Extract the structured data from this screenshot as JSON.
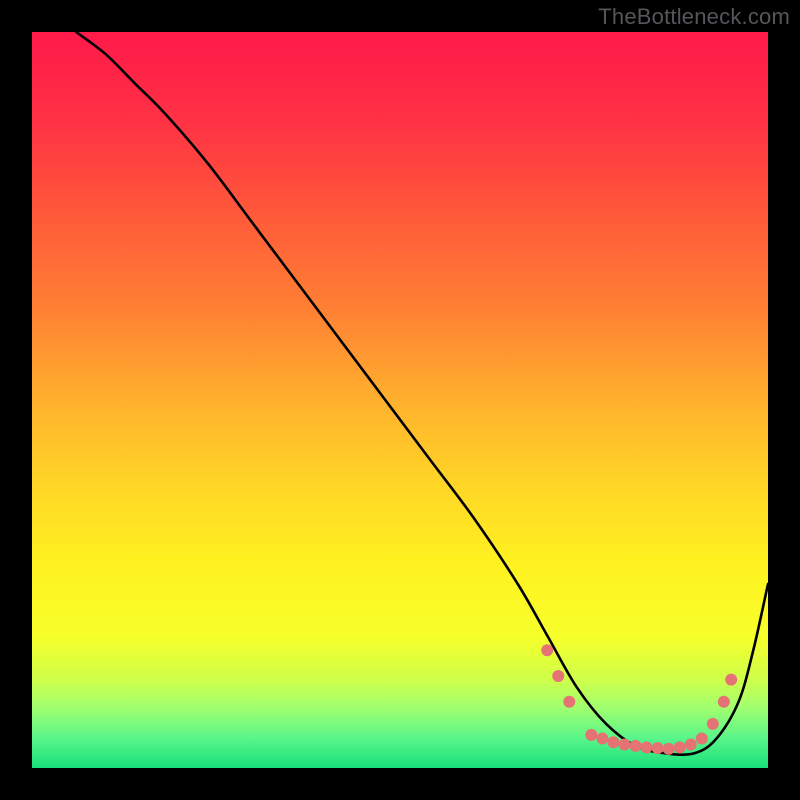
{
  "watermark": "TheBottleneck.com",
  "chart_data": {
    "type": "line",
    "title": "",
    "xlabel": "",
    "ylabel": "",
    "xlim": [
      0,
      100
    ],
    "ylim": [
      0,
      100
    ],
    "grid": false,
    "legend": false,
    "gradient_stops": [
      {
        "offset": 0,
        "color": "#ff1a4a"
      },
      {
        "offset": 12,
        "color": "#ff3144"
      },
      {
        "offset": 25,
        "color": "#ff5a3a"
      },
      {
        "offset": 38,
        "color": "#ff8133"
      },
      {
        "offset": 50,
        "color": "#ffb02d"
      },
      {
        "offset": 62,
        "color": "#ffd726"
      },
      {
        "offset": 72,
        "color": "#fff120"
      },
      {
        "offset": 82,
        "color": "#f7ff2a"
      },
      {
        "offset": 88,
        "color": "#cfff4a"
      },
      {
        "offset": 92,
        "color": "#9eff70"
      },
      {
        "offset": 96,
        "color": "#58f58a"
      },
      {
        "offset": 100,
        "color": "#18e07a"
      }
    ],
    "series": [
      {
        "name": "curve",
        "x": [
          6,
          10,
          14,
          18,
          24,
          30,
          36,
          42,
          48,
          54,
          60,
          66,
          70,
          74,
          78,
          82,
          86,
          90,
          93,
          96,
          98,
          100
        ],
        "y": [
          100,
          97,
          93,
          89,
          82,
          74,
          66,
          58,
          50,
          42,
          34,
          25,
          18,
          11,
          6,
          3,
          2,
          2,
          4,
          9,
          16,
          25
        ]
      }
    ],
    "markers": {
      "name": "highlight-dots",
      "color": "#e57373",
      "points": [
        {
          "x": 70.0,
          "y": 16.0
        },
        {
          "x": 71.5,
          "y": 12.5
        },
        {
          "x": 73.0,
          "y": 9.0
        },
        {
          "x": 76.0,
          "y": 4.5
        },
        {
          "x": 77.5,
          "y": 4.0
        },
        {
          "x": 79.0,
          "y": 3.5
        },
        {
          "x": 80.5,
          "y": 3.2
        },
        {
          "x": 82.0,
          "y": 3.0
        },
        {
          "x": 83.5,
          "y": 2.8
        },
        {
          "x": 85.0,
          "y": 2.7
        },
        {
          "x": 86.5,
          "y": 2.6
        },
        {
          "x": 88.0,
          "y": 2.8
        },
        {
          "x": 89.5,
          "y": 3.2
        },
        {
          "x": 91.0,
          "y": 4.0
        },
        {
          "x": 92.5,
          "y": 6.0
        },
        {
          "x": 94.0,
          "y": 9.0
        },
        {
          "x": 95.0,
          "y": 12.0
        }
      ]
    }
  }
}
